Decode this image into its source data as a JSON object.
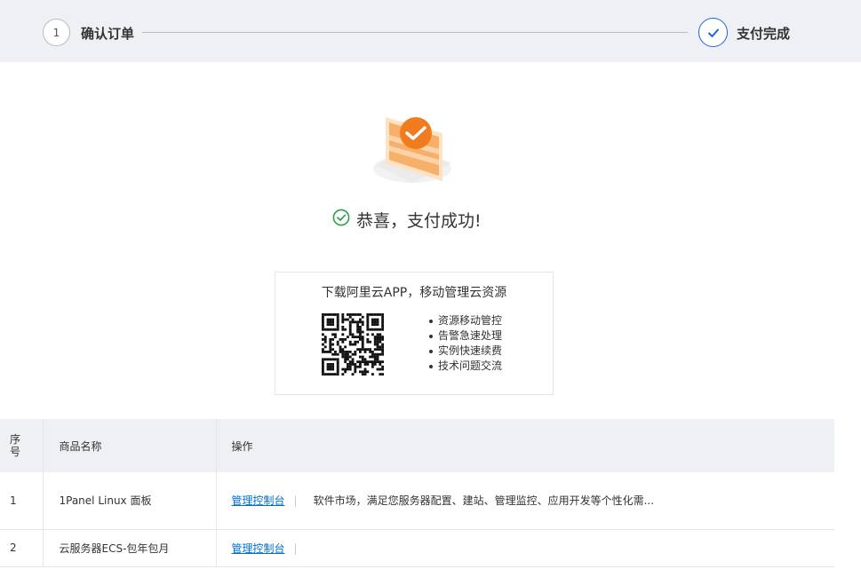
{
  "steps": [
    {
      "number": "1",
      "label": "确认订单"
    },
    {
      "label": "支付完成"
    }
  ],
  "success": {
    "message": "恭喜，支付成功!"
  },
  "app_promo": {
    "title": "下载阿里云APP，移动管理云资源",
    "features": [
      "资源移动管控",
      "告警急速处理",
      "实例快速续费",
      "技术问题交流"
    ]
  },
  "table": {
    "headers": {
      "no": "序号",
      "name": "商品名称",
      "op": "操作"
    },
    "rows": [
      {
        "no": "1",
        "name": "1Panel Linux 面板",
        "link": "管理控制台",
        "separator": "|",
        "desc": "软件市场，满足您服务器配置、建站、管理监控、应用开发等个性化需..."
      },
      {
        "no": "2",
        "name": "云服务器ECS-包年包月",
        "link": "管理控制台",
        "separator": "|"
      }
    ]
  },
  "colors": {
    "accent": "#1e63e6",
    "success": "#2e9e4f",
    "link": "#0070cc",
    "brand_orange": "#f07c1f"
  }
}
